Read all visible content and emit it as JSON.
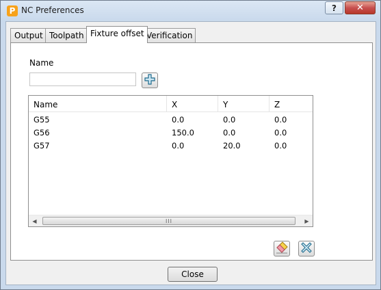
{
  "window": {
    "title": "NC Preferences",
    "app_icon_letter": "P",
    "help_label": "?",
    "close_label": "✕"
  },
  "tabs": [
    {
      "label": "Output",
      "active": false
    },
    {
      "label": "Toolpath",
      "active": false
    },
    {
      "label": "Fixture offset",
      "active": true
    },
    {
      "label": "Verification",
      "active": false
    }
  ],
  "fixture_offset": {
    "name_label": "Name",
    "name_value": "",
    "add_icon": "plus-icon",
    "columns": [
      "Name",
      "X",
      "Y",
      "Z"
    ],
    "rows": [
      {
        "name": "G55",
        "x": "0.0",
        "y": "0.0",
        "z": "0.0"
      },
      {
        "name": "G56",
        "x": "150.0",
        "y": "0.0",
        "z": "0.0"
      },
      {
        "name": "G57",
        "x": "0.0",
        "y": "20.0",
        "z": "0.0"
      }
    ],
    "scroll": {
      "left": "◀",
      "right": "▶",
      "thumb": "III"
    },
    "actions": [
      {
        "icon": "eraser-icon"
      },
      {
        "icon": "delete-cross-icon"
      }
    ]
  },
  "footer": {
    "close_button": "Close"
  }
}
